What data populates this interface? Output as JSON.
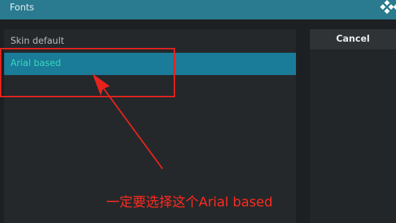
{
  "dialog": {
    "title": "Fonts",
    "logo_icon": "kodi-logo-icon"
  },
  "list": {
    "items": [
      {
        "label": "Skin default",
        "selected": false
      },
      {
        "label": "Arial based",
        "selected": true
      }
    ]
  },
  "buttons": {
    "cancel_label": "Cancel"
  },
  "annotation": {
    "text": "一定要选择这个Arial based",
    "color": "#ff2a1f"
  },
  "colors": {
    "titlebar": "#2a7b8f",
    "selected_row": "#1a7c98",
    "selected_text": "#3ad7be",
    "background": "#1d2023"
  }
}
